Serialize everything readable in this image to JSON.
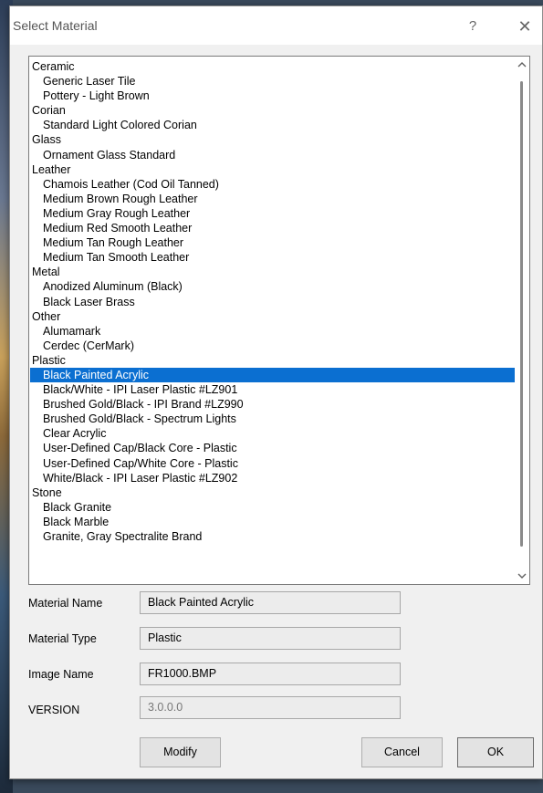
{
  "dialog": {
    "title": "Select Material",
    "help_label": "?",
    "close_label": "✕"
  },
  "materials": [
    {
      "label": "Ceramic",
      "category": true
    },
    {
      "label": "Generic Laser Tile"
    },
    {
      "label": "Pottery - Light Brown"
    },
    {
      "label": "Corian",
      "category": true
    },
    {
      "label": "Standard Light Colored Corian"
    },
    {
      "label": "Glass",
      "category": true
    },
    {
      "label": "Ornament Glass Standard"
    },
    {
      "label": "Leather",
      "category": true
    },
    {
      "label": "Chamois Leather (Cod Oil Tanned)"
    },
    {
      "label": "Medium Brown Rough Leather"
    },
    {
      "label": "Medium Gray Rough Leather"
    },
    {
      "label": "Medium Red Smooth Leather"
    },
    {
      "label": "Medium Tan Rough Leather"
    },
    {
      "label": "Medium Tan Smooth Leather"
    },
    {
      "label": "Metal",
      "category": true
    },
    {
      "label": "Anodized Aluminum (Black)"
    },
    {
      "label": "Black Laser Brass"
    },
    {
      "label": "Other",
      "category": true
    },
    {
      "label": "Alumamark"
    },
    {
      "label": "Cerdec (CerMark)"
    },
    {
      "label": "Plastic",
      "category": true
    },
    {
      "label": "Black Painted Acrylic",
      "selected": true
    },
    {
      "label": "Black/White - IPI Laser Plastic #LZ901"
    },
    {
      "label": "Brushed Gold/Black - IPI Brand #LZ990"
    },
    {
      "label": "Brushed Gold/Black - Spectrum Lights"
    },
    {
      "label": "Clear Acrylic"
    },
    {
      "label": "User-Defined Cap/Black Core - Plastic"
    },
    {
      "label": "User-Defined Cap/White Core - Plastic"
    },
    {
      "label": "White/Black - IPI Laser Plastic #LZ902"
    },
    {
      "label": "Stone",
      "category": true
    },
    {
      "label": "Black Granite"
    },
    {
      "label": "Black Marble"
    },
    {
      "label": "Granite, Gray Spectralite Brand"
    }
  ],
  "fields": {
    "material_name": {
      "label": "Material Name",
      "value": "Black Painted Acrylic"
    },
    "material_type": {
      "label": "Material Type",
      "value": "Plastic"
    },
    "image_name": {
      "label": "Image Name",
      "value": "FR1000.BMP"
    },
    "version": {
      "label": "VERSION",
      "value": "3.0.0.0"
    }
  },
  "buttons": {
    "modify": "Modify",
    "cancel": "Cancel",
    "ok": "OK"
  },
  "colors": {
    "selection": "#0b6fd1",
    "dialog_bg": "#f0f0f0"
  }
}
